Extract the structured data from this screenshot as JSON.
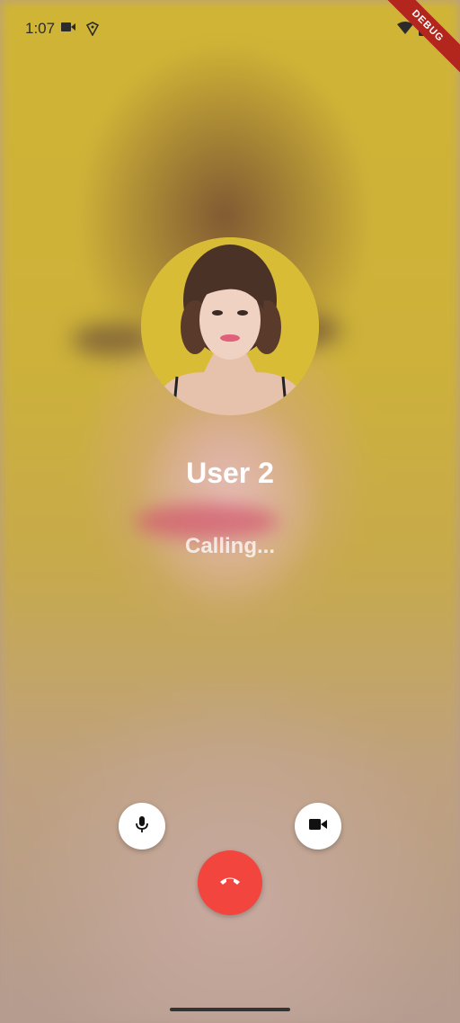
{
  "status_bar": {
    "time": "1:07",
    "debug_label": "DEBUG"
  },
  "caller": {
    "name": "User 2",
    "status": "Calling..."
  },
  "controls": {
    "mute_icon": "mic-icon",
    "video_icon": "videocam-icon",
    "end_icon": "call-end-icon"
  },
  "colors": {
    "end_call": "#f2453d",
    "text_primary": "#ffffff",
    "avatar_bg": "#d8bc35"
  }
}
